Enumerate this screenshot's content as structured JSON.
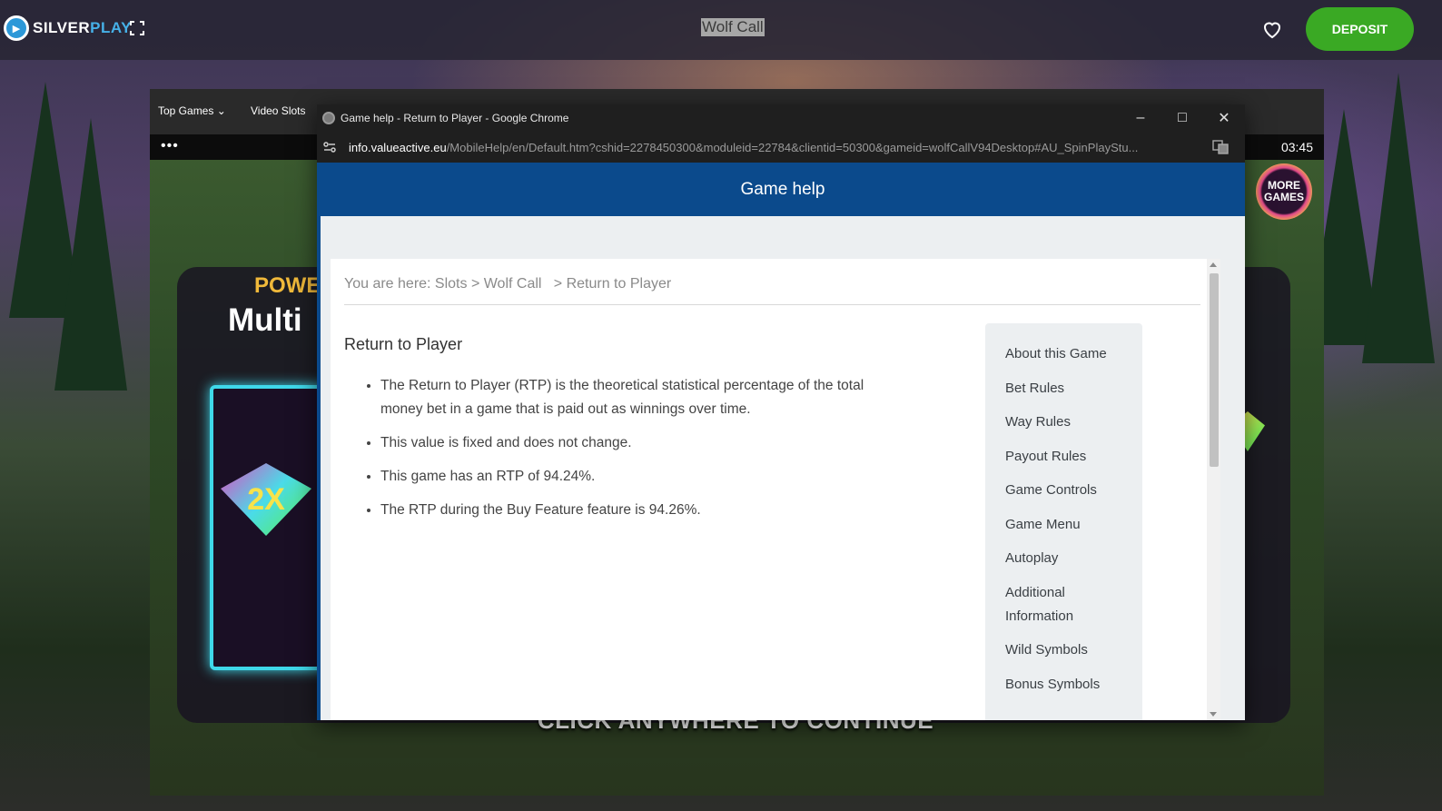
{
  "site": {
    "brand_part1": "SILVER",
    "brand_part2": "PLAY",
    "game_title": "Wolf Call",
    "deposit_label": "DEPOSIT",
    "colors": {
      "deposit": "#3aa924",
      "brand_blue": "#46b1e8"
    }
  },
  "game": {
    "nav": [
      "Top Games",
      "Video Slots"
    ],
    "time": "03:45",
    "more_games": "MORE GAMES",
    "power_text": "POWE",
    "multi_text": "Multi",
    "gem_label": "2X",
    "continue_text": "CLICK ANYWHERE TO CONTINUE",
    "menu_dots": "•••"
  },
  "chrome": {
    "window_title": "Game help - Return to Player - Google Chrome",
    "url_host": "info.valueactive.eu",
    "url_path": "/MobileHelp/en/Default.htm?cshid=2278450300&moduleid=22784&clientid=50300&gameid=wolfCallV94Desktop#AU_SpinPlayStu...",
    "buttons": {
      "minimize": "–",
      "maximize": "□",
      "close": "✕"
    }
  },
  "help": {
    "header": "Game help",
    "breadcrumb": "You are here: Slots > Wolf Call   > Return to Player",
    "title": "Return to Player",
    "bullets": [
      "The Return to Player (RTP) is the theoretical statistical percentage of the total money bet in a game that is paid out as winnings over time.",
      "This value is fixed and does not change.",
      "This game has an RTP of 94.24%.",
      "The RTP during the Buy Feature feature is 94.26%."
    ],
    "menu": [
      "About this Game",
      "Bet Rules",
      "Way Rules",
      "Payout Rules",
      "Game Controls",
      "Game Menu",
      "Autoplay",
      "Additional Information",
      "Wild Symbols",
      "Bonus Symbols"
    ],
    "colors": {
      "header_bg": "#0b4a8c"
    }
  }
}
